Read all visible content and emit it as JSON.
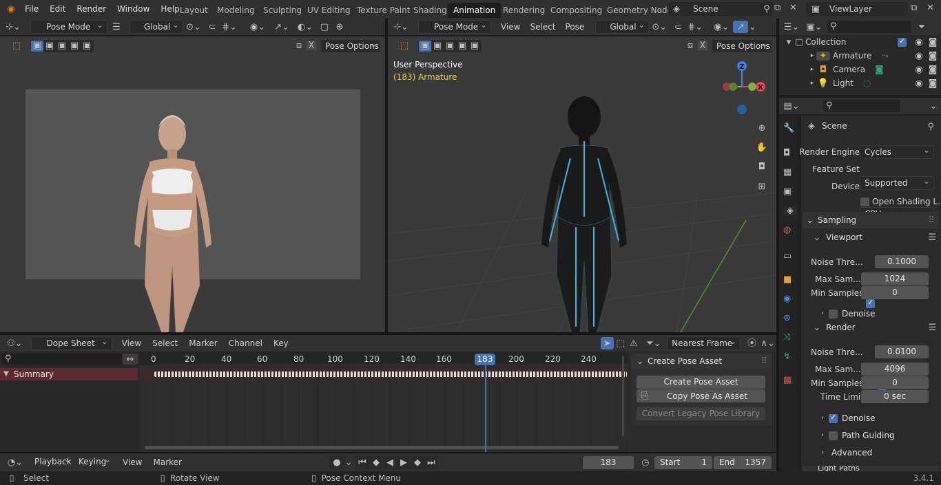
{
  "topbar": {
    "menus": [
      "File",
      "Edit",
      "Render",
      "Window",
      "Help"
    ],
    "workspaces": [
      "Layout",
      "Modeling",
      "Sculpting",
      "UV Editing",
      "Texture Paint",
      "Shading",
      "Animation",
      "Rendering",
      "Compositing",
      "Geometry Node"
    ],
    "active_workspace": "Animation",
    "scene": "Scene",
    "view_layer": "ViewLayer"
  },
  "viewport_left": {
    "mode": "Pose Mode",
    "orientation": "Global",
    "pose_options": "Pose Options"
  },
  "viewport_right": {
    "mode": "Pose Mode",
    "menus": [
      "View",
      "Select",
      "Pose"
    ],
    "orientation": "Global",
    "pose_options": "Pose Options",
    "overlay_title": "User Perspective",
    "overlay_object": "(183) Armature",
    "gizmo_z": "Z",
    "gizmo_x": "X"
  },
  "outliner": {
    "collection": "Collection",
    "items": [
      "Armature",
      "Camera",
      "Light"
    ]
  },
  "properties": {
    "context": "Scene",
    "render_engine_label": "Render Engine",
    "render_engine": "Cycles",
    "feature_set_label": "Feature Set",
    "feature_set": "Supported",
    "device_label": "Device",
    "device": "CPU",
    "open_shading": "Open Shading L...",
    "sampling": "Sampling",
    "viewport": "Viewport",
    "vp_noise_label": "Noise Thre...",
    "vp_noise": "0.1000",
    "vp_max_label": "Max Sam...",
    "vp_max": "1024",
    "vp_min_label": "Min Samples",
    "vp_min": "0",
    "vp_denoise": "Denoise",
    "render": "Render",
    "r_noise_label": "Noise Thre...",
    "r_noise": "0.0100",
    "r_max_label": "Max Sam...",
    "r_max": "4096",
    "r_min_label": "Min Samples",
    "r_min": "0",
    "time_limit_label": "Time Limit",
    "time_limit": "0 sec",
    "r_denoise": "Denoise",
    "path_guiding": "Path Guiding",
    "advanced": "Advanced",
    "light_paths": "Light Paths"
  },
  "dopesheet": {
    "mode": "Dope Sheet",
    "menus": [
      "View",
      "Select",
      "Marker",
      "Channel",
      "Key"
    ],
    "snap": "Nearest Frame",
    "channel": "Summary",
    "ruler": [
      "0",
      "20",
      "40",
      "60",
      "80",
      "100",
      "120",
      "140",
      "160",
      "180",
      "200",
      "220",
      "240"
    ],
    "current_frame": "183",
    "panel_title": "Create Pose Asset",
    "create_pose_asset": "Create Pose Asset",
    "copy_pose_as_asset": "Copy Pose As Asset",
    "convert_legacy": "Convert Legacy Pose Library"
  },
  "timeline": {
    "menus": [
      "Playback",
      "Keying",
      "View",
      "Marker"
    ],
    "frame": "183",
    "start_label": "Start",
    "start": "1",
    "end_label": "End",
    "end": "1357"
  },
  "statusbar": {
    "select": "Select",
    "rotate": "Rotate View",
    "context": "Pose Context Menu",
    "version": "3.4.1"
  }
}
